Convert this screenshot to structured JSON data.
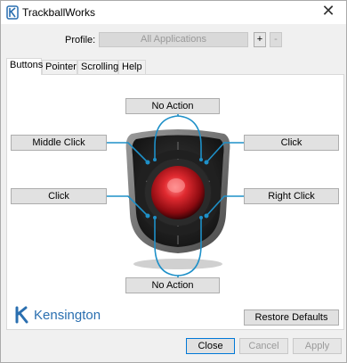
{
  "window": {
    "title": "TrackballWorks"
  },
  "profile": {
    "label": "Profile:",
    "value": "All Applications",
    "add_label": "+",
    "remove_label": "-"
  },
  "tabs": [
    {
      "label": "Buttons",
      "active": true
    },
    {
      "label": "Pointer"
    },
    {
      "label": "Scrolling"
    },
    {
      "label": "Help"
    }
  ],
  "buttons": {
    "top": "No Action",
    "upper_left": "Middle Click",
    "upper_right": "Click",
    "lower_left": "Click",
    "lower_right": "Right Click",
    "bottom": "No Action"
  },
  "brand": {
    "logo_text": "Kensington",
    "color": "#2a6fb0"
  },
  "restore_label": "Restore Defaults",
  "footer": {
    "close_label": "Close",
    "cancel_label": "Cancel",
    "apply_label": "Apply"
  },
  "colors": {
    "connector": "#1e90c8",
    "ball": "#d81c25"
  }
}
